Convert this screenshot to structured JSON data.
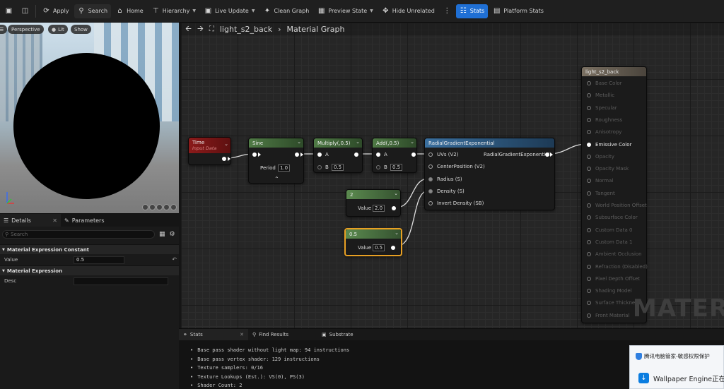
{
  "toolbar": {
    "apply": "Apply",
    "search": "Search",
    "home": "Home",
    "hierarchy": "Hierarchy",
    "live_update": "Live Update",
    "clean_graph": "Clean Graph",
    "preview_state": "Preview State",
    "hide_unrelated": "Hide Unrelated",
    "stats": "Stats",
    "platform_stats": "Platform Stats"
  },
  "viewport": {
    "perspective": "Perspective",
    "lit": "Lit",
    "show": "Show"
  },
  "details": {
    "tab_details": "Details",
    "tab_parameters": "Parameters",
    "search_placeholder": "Search",
    "category1": "Material Expression Constant",
    "value_label": "Value",
    "value": "0.5",
    "category2": "Material Expression",
    "desc_label": "Desc",
    "desc": ""
  },
  "graph": {
    "breadcrumb_asset": "light_s2_back",
    "breadcrumb_page": "Material Graph",
    "watermark": "MATER",
    "nodes": {
      "time": {
        "title": "Time",
        "subtitle": "Input Data"
      },
      "sine": {
        "title": "Sine",
        "period_label": "Period",
        "period": "1.0"
      },
      "multiply": {
        "title": "Multiply(,0.5)",
        "a": "A",
        "b": "B",
        "b_val": "0.5"
      },
      "add": {
        "title": "Add(,0.5)",
        "a": "A",
        "b": "B",
        "b_val": "0.5"
      },
      "radial": {
        "title": "RadialGradientExponential",
        "uvs": "UVs (V2)",
        "center": "CenterPosition (V2)",
        "radius": "Radius (S)",
        "density": "Density (S)",
        "invert": "Invert Density (SB)",
        "output": "RadialGradientExponential"
      },
      "const2": {
        "title": "2",
        "label": "Value",
        "value": "2.0"
      },
      "const05": {
        "title": "0.5",
        "label": "Value",
        "value": "0.5"
      },
      "material": {
        "title": "light_s2_back",
        "pins": [
          "Base Color",
          "Metallic",
          "Specular",
          "Roughness",
          "Anisotropy",
          "Emissive Color",
          "Opacity",
          "Opacity Mask",
          "Normal",
          "Tangent",
          "World Position Offset",
          "Subsurface Color",
          "Custom Data 0",
          "Custom Data 1",
          "Ambient Occlusion",
          "Refraction (Disabled)",
          "Pixel Depth Offset",
          "Shading Model",
          "Surface Thickness",
          "Front Material"
        ]
      }
    }
  },
  "bottom": {
    "tab_stats": "Stats",
    "tab_find": "Find Results",
    "tab_substrate": "Substrate",
    "lines": [
      "Base pass shader without light map: 94 instructions",
      "Base pass vertex shader: 129 instructions",
      "Texture samplers: 0/16",
      "Texture Lookups (Est.): VS(0), PS(3)",
      "Shader Count: 2"
    ]
  },
  "toast": {
    "line1": "腾讯电脑管家-敏感权限保护",
    "line2": "Wallpaper Engine正在"
  },
  "colors": {
    "accent": "#1f6fd4",
    "time_header": "#8b1a1a",
    "math_header": "#3e6b35",
    "func_header": "#2f5d8a",
    "selected": "#e8a023"
  }
}
